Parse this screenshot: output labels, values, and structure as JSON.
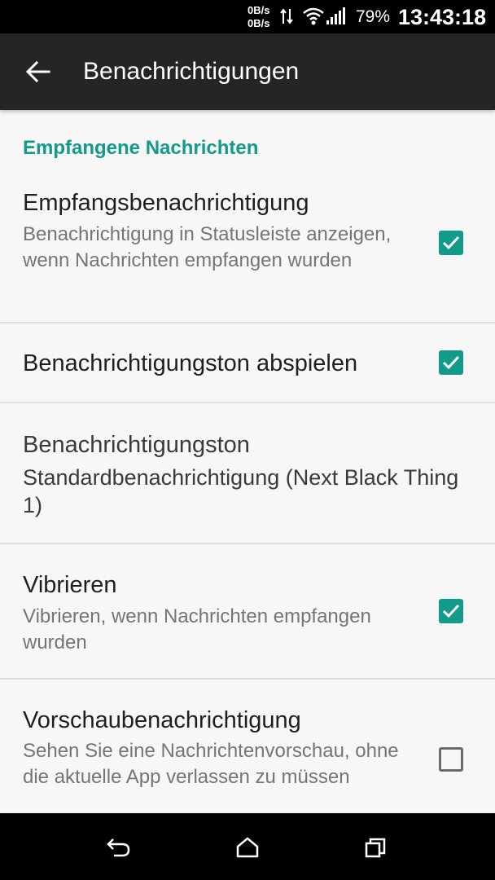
{
  "status_bar": {
    "speed_up": "0B/s",
    "speed_down": "0B/s",
    "battery": "79%",
    "time": "13:43:18",
    "icons": [
      "data-arrows-icon",
      "wifi-icon",
      "signal-icon"
    ]
  },
  "toolbar": {
    "back_icon": "arrow-back-icon",
    "title": "Benachrichtigungen"
  },
  "section": {
    "header": "Empfangene Nachrichten"
  },
  "settings": [
    {
      "title": "Empfangsbenachrichtigung",
      "summary": "Benachrichtigung in Statusleiste anzeigen, wenn Nachrichten empfangen wurden",
      "checked": true
    },
    {
      "title": "Benachrichtigungston abspielen",
      "summary": "",
      "checked": true
    },
    {
      "title": "Benachrichtigungston",
      "summary": "Standardbenachrichtigung (Next Black Thing 1)"
    },
    {
      "title": "Vibrieren",
      "summary": "Vibrieren, wenn Nachrichten empfangen wurden",
      "checked": true
    },
    {
      "title": "Vorschaubenachrichtigung",
      "summary": "Sehen Sie eine Nachrichtenvorschau, ohne die aktuelle App verlassen zu müssen",
      "checked": false
    }
  ],
  "colors": {
    "accent": "#129a8a",
    "toolbar": "#252525",
    "background": "#f7f7f7"
  },
  "nav_bar": {
    "icons": [
      "back-icon",
      "home-icon",
      "recents-icon"
    ]
  }
}
